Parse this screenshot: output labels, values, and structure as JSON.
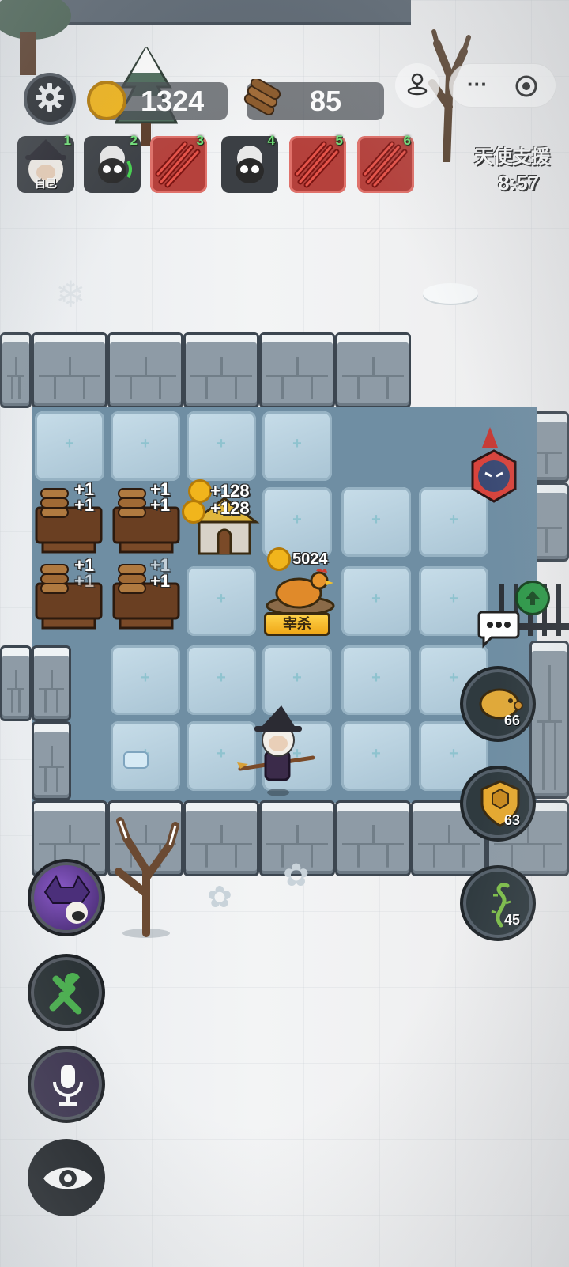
{
  "hud": {
    "gold": "1324",
    "wood": "85"
  },
  "players": [
    {
      "num": "1",
      "label": "自己",
      "type": "self"
    },
    {
      "num": "2",
      "label": "",
      "type": "sheep"
    },
    {
      "num": "3",
      "label": "",
      "type": "attacked"
    },
    {
      "num": "4",
      "label": "",
      "type": "sheep"
    },
    {
      "num": "5",
      "label": "",
      "type": "attacked"
    },
    {
      "num": "6",
      "label": "",
      "type": "attacked"
    }
  ],
  "event": {
    "title": "天使支援",
    "timer": "8:57"
  },
  "board": {
    "lumber1_gain": "+1",
    "lumber1_gain2": "+1",
    "lumber2_gain": "+1",
    "lumber2_gain2": "+1",
    "lumber3_gain": "+1",
    "lumber3_gain2": "+1",
    "lumber4_gain": "+1",
    "lumber4_gain2": "+1",
    "house_gain": "+128",
    "house_gain2": "+128",
    "chicken_value": "5024",
    "slaughter_label": "宰杀"
  },
  "right_buttons": {
    "piggy_count": "66",
    "shield_count": "63",
    "vine_count": "45"
  },
  "icons": {
    "settings": "gear-icon",
    "gold": "gold-coin-icon",
    "wood": "wood-logs-icon",
    "miniapp_menu": "more-dots-icon",
    "miniapp_close": "target-circle-icon",
    "chat": "chat-bubble-icon",
    "build": "tools-icon",
    "voice": "microphone-icon",
    "view": "eye-icon",
    "upgrade": "arrow-up-icon"
  },
  "colors": {
    "hud_bg": "#4b5055",
    "count_green": "#72e07a",
    "alert_red": "#b5413c",
    "ice_tile": "#b9d2e0",
    "gold": "#f1b51c"
  }
}
